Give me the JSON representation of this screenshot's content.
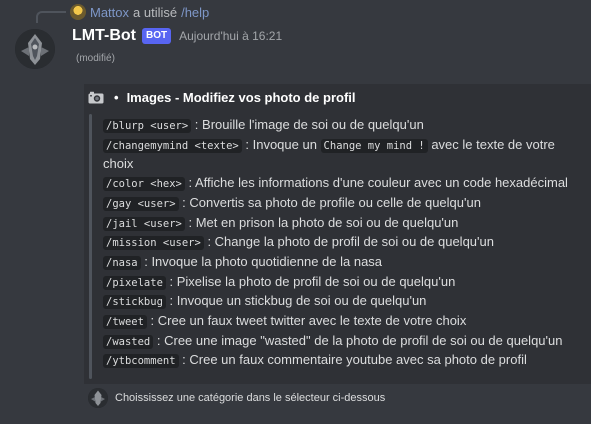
{
  "reply": {
    "user": "Mattox",
    "text": "a utilisé",
    "command": "/help"
  },
  "message": {
    "author": "LMT-Bot",
    "bot_tag": "BOT",
    "timestamp": "Aujourd'hui à 16:21",
    "edited": "(modifié)"
  },
  "embed": {
    "bullet": "•",
    "title": "Images - Modifiez vos photo de profil",
    "commands": [
      {
        "cmd": "/blurp <user>",
        "desc": " : Brouille l'image de soi ou de quelqu'un"
      },
      {
        "cmd": "/changemymind <texte>",
        "desc": " : Invoque un ",
        "code2": "Change my mind !",
        "desc2": " avec le texte de votre choix"
      },
      {
        "cmd": "/color <hex>",
        "desc": " : Affiche les informations d'une couleur avec un code hexadécimal"
      },
      {
        "cmd": "/gay <user>",
        "desc": " : Convertis sa photo de profile ou celle de quelqu'un"
      },
      {
        "cmd": "/jail <user>",
        "desc": " : Met en prison la photo de soi ou de quelqu'un"
      },
      {
        "cmd": "/mission <user>",
        "desc": " : Change la photo de profil de soi ou de quelqu'un"
      },
      {
        "cmd": "/nasa",
        "desc": " : Invoque la photo quotidienne de la nasa"
      },
      {
        "cmd": "/pixelate",
        "desc": " : Pixelise la photo de profil de soi ou de quelqu'un"
      },
      {
        "cmd": "/stickbug",
        "desc": " : Invoque un stickbug de soi ou de quelqu'un"
      },
      {
        "cmd": "/tweet",
        "desc": " : Cree un faux tweet twitter avec le texte de votre choix"
      },
      {
        "cmd": "/wasted",
        "desc": " : Cree une image \"wasted\" de la photo de profil de soi ou de quelqu'un"
      },
      {
        "cmd": "/ytbcomment",
        "desc": " : Cree un faux commentaire youtube avec sa photo de profil"
      }
    ],
    "footer": "Choississez une catégorie dans le sélecteur ci-dessous"
  },
  "colors": {
    "background": "#36393f",
    "embed": "#2f3136",
    "bot_tag": "#5865f2",
    "link": "#7e97c8"
  },
  "icons": {
    "title_icon": "camera-icon",
    "reply_avatar": "mattox-avatar",
    "bot_avatar": "lmt-bot-avatar"
  }
}
